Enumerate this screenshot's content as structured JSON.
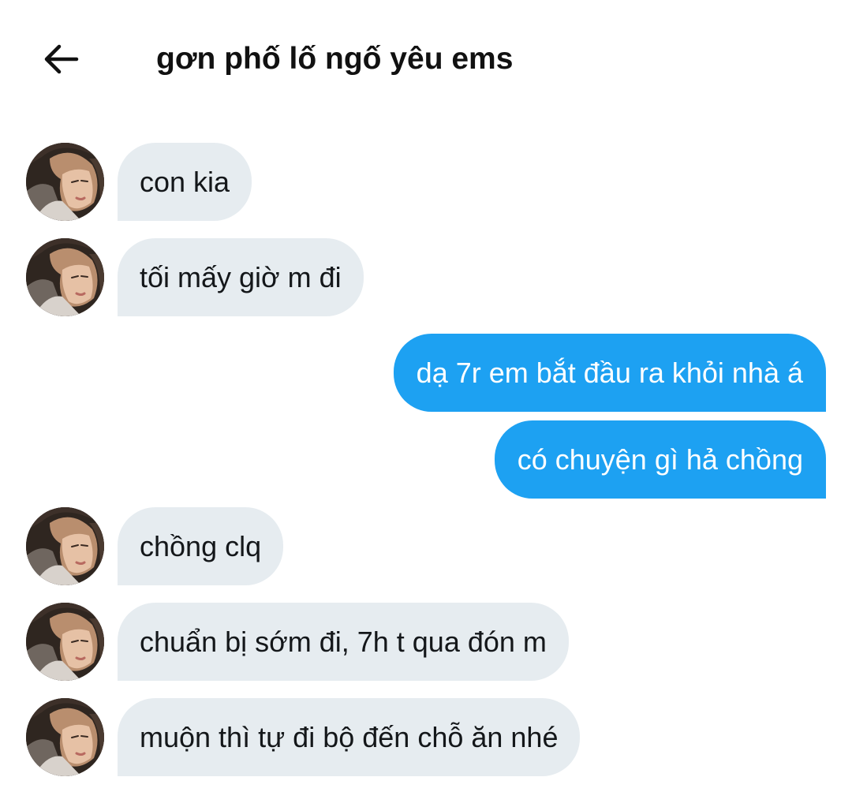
{
  "header": {
    "back_icon": "arrow-left-icon",
    "title": "gơn phố lố ngố yêu ems"
  },
  "colors": {
    "incoming_bubble": "#e6ecf0",
    "outgoing_bubble": "#1da1f2",
    "outgoing_text": "#ffffff",
    "incoming_text": "#14171a"
  },
  "messages": [
    {
      "direction": "incoming",
      "text": "con kia"
    },
    {
      "direction": "incoming",
      "text": "tối mấy giờ m đi"
    },
    {
      "direction": "outgoing",
      "text": "dạ 7r em bắt đầu ra khỏi nhà á"
    },
    {
      "direction": "outgoing",
      "text": "có chuyện gì hả chồng"
    },
    {
      "direction": "incoming",
      "text": "chồng clq"
    },
    {
      "direction": "incoming",
      "text": "chuẩn bị sớm đi, 7h t qua đón m"
    },
    {
      "direction": "incoming",
      "text": "muộn thì tự đi bộ đến chỗ ăn nhé"
    }
  ]
}
